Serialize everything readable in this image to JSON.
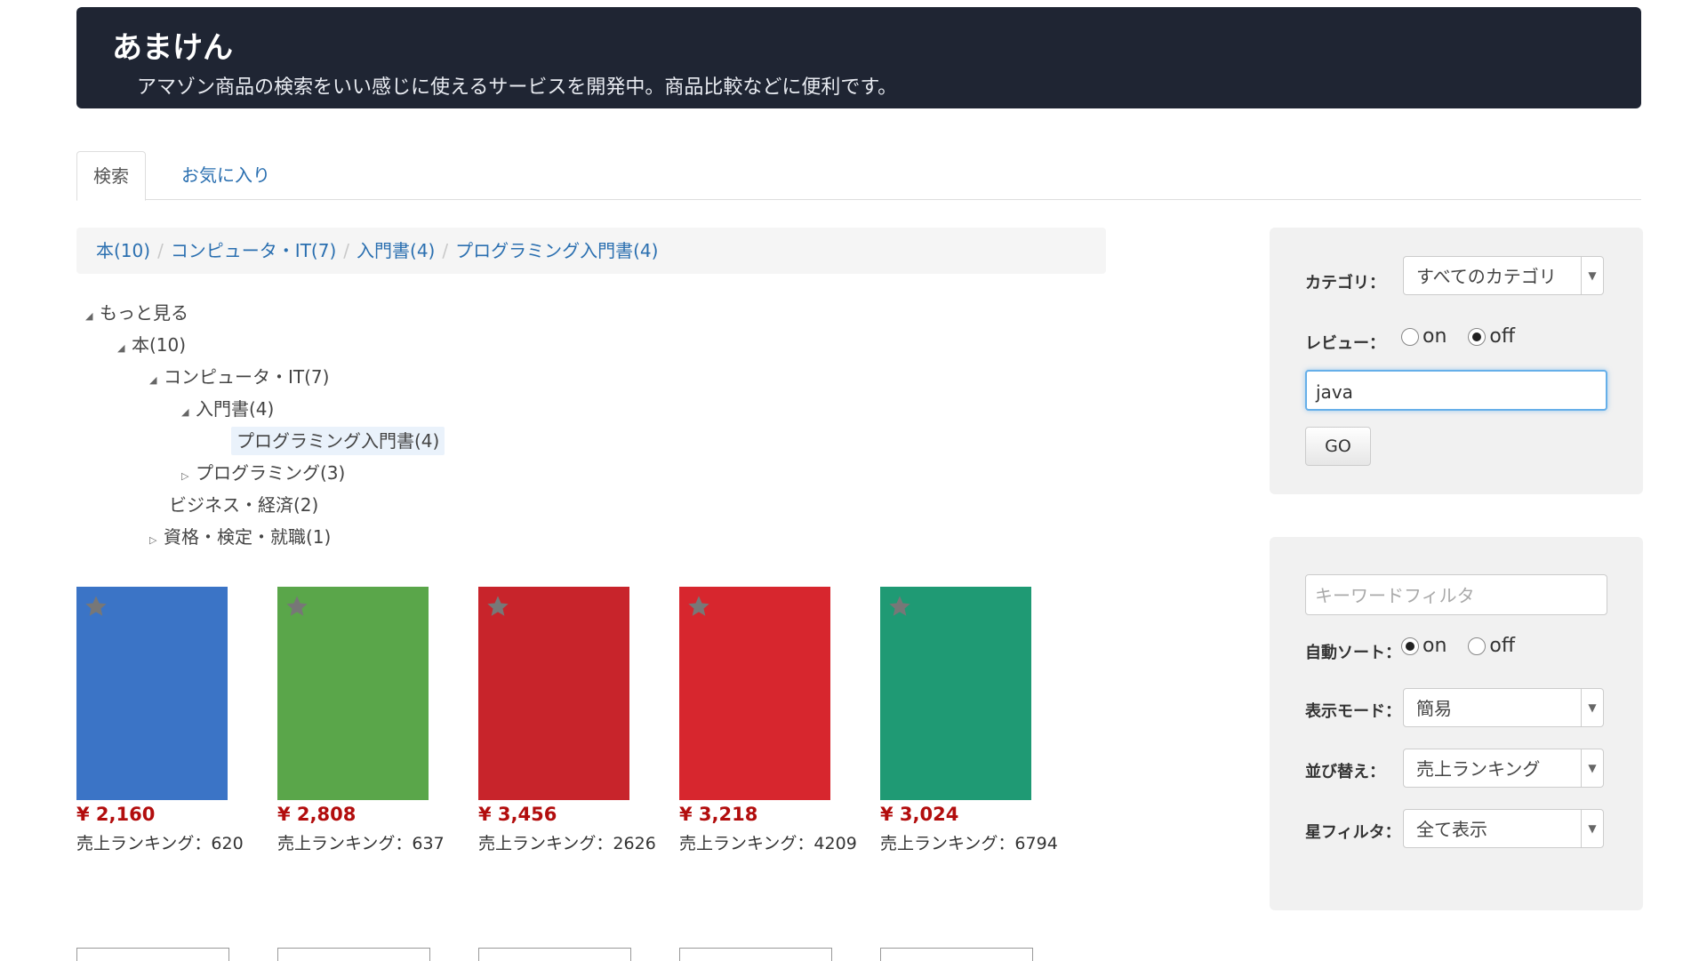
{
  "header": {
    "title": "あまけん",
    "subtitle": "アマゾン商品の検索をいい感じに使えるサービスを開発中。商品比較などに便利です。"
  },
  "tabs": [
    {
      "label": "検索",
      "active": true
    },
    {
      "label": "お気に入り",
      "active": false
    }
  ],
  "breadcrumb": [
    "本(10)",
    "コンピュータ・IT(7)",
    "入門書(4)",
    "プログラミング入門書(4)"
  ],
  "tree": {
    "more": "もっと見る",
    "books": "本(10)",
    "computer_it": "コンピュータ・IT(7)",
    "intro": "入門書(4)",
    "programming_intro": "プログラミング入門書(4)",
    "programming": "プログラミング(3)",
    "business": "ビジネス・経済(2)",
    "qualification": "資格・検定・就職(1)"
  },
  "products": [
    {
      "price": "¥ 2,160",
      "rank": "売上ランキング：620",
      "color": "#3b74c6"
    },
    {
      "price": "¥ 2,808",
      "rank": "売上ランキング：637",
      "color": "#5aa64a"
    },
    {
      "price": "¥ 3,456",
      "rank": "売上ランキング：2626",
      "color": "#c8242b"
    },
    {
      "price": "¥ 3,218",
      "rank": "売上ランキング：4209",
      "color": "#d7262e"
    },
    {
      "price": "¥ 3,024",
      "rank": "売上ランキング：6794",
      "color": "#1f9a74"
    }
  ],
  "search_panel": {
    "category_label": "カテゴリ：",
    "category_value": "すべてのカテゴリ",
    "review_label": "レビュー：",
    "radio_on": "on",
    "radio_off": "off",
    "query": "java",
    "go": "GO"
  },
  "filter_panel": {
    "keyword_placeholder": "キーワードフィルタ",
    "autosort_label": "自動ソート：",
    "radio_on": "on",
    "radio_off": "off",
    "display_label": "表示モード：",
    "display_value": "簡易",
    "sort_label": "並び替え：",
    "sort_value": "売上ランキング",
    "star_label": "星フィルタ：",
    "star_value": "全て表示"
  }
}
